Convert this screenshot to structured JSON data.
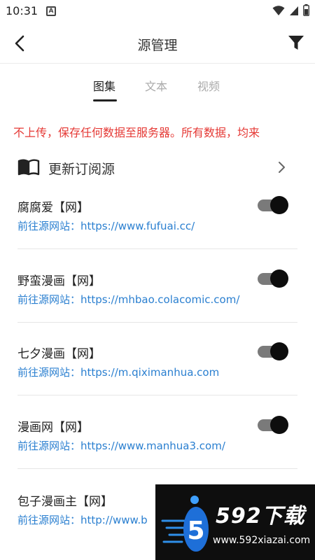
{
  "status_bar": {
    "time": "10:31",
    "notification_icon": "a-notification-icon",
    "icons": [
      "wifi-icon",
      "signal-icon",
      "battery-icon"
    ]
  },
  "toolbar": {
    "back_icon": "chevron-left-icon",
    "title": "源管理",
    "filter_icon": "filter-icon"
  },
  "tabs": [
    {
      "label": "图集",
      "active": true
    },
    {
      "label": "文本",
      "active": false
    },
    {
      "label": "视频",
      "active": false
    }
  ],
  "notice": {
    "text": "不上传，保存任何数据至服务器。所有数据，均来",
    "color": "#e53935"
  },
  "update_row": {
    "icon": "book-icon",
    "label": "更新订阅源",
    "chevron_icon": "chevron-right-icon"
  },
  "sources": [
    {
      "name": "腐腐爱【网】",
      "link": "前往源网站：https://www.fufuai.cc/",
      "enabled": true
    },
    {
      "name": "野蛮漫画【网】",
      "link": "前往源网站：https://mhbao.colacomic.com/",
      "enabled": true
    },
    {
      "name": "七夕漫画【网】",
      "link": "前往源网站：https://m.qiximanhua.com",
      "enabled": true
    },
    {
      "name": "漫画网【网】",
      "link": "前往源网站：https://www.manhua3.com/",
      "enabled": true
    },
    {
      "name": "包子漫画主【网】",
      "link": "前往源网站：http://www.b",
      "enabled": true
    }
  ],
  "watermark": {
    "brand": "592下载",
    "url": "www.592xiazai.com",
    "logo_char": "5"
  },
  "colors": {
    "link": "#2a7fd0",
    "toggle_track": "#7a7a7a",
    "toggle_knob": "#0d0d0d"
  }
}
